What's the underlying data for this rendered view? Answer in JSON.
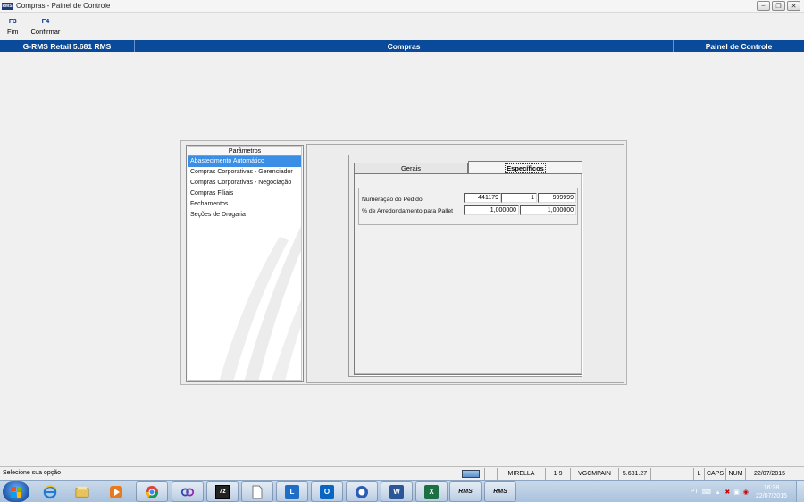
{
  "window": {
    "title": "Compras - Painel de Controle",
    "logo_text": "RMS"
  },
  "function_keys": [
    {
      "key": "F3",
      "label": "Fim"
    },
    {
      "key": "F4",
      "label": "Confirmar"
    }
  ],
  "header": {
    "left": "G-RMS Retail 5.681 RMS",
    "center": "Compras",
    "right": "Painel de Controle"
  },
  "parametros": {
    "title": "Parâmetros",
    "items": [
      "Abastecimento Automático",
      "Compras Corporativas - Gerenciador",
      "Compras Corporativas - Negociação",
      "Compras Filiais",
      "Fechamentos",
      "Seções de Drogaria"
    ],
    "selected_index": 0
  },
  "tabs": {
    "gerais": "Gerais",
    "especificos": "Específicos",
    "active": "especificos"
  },
  "form": {
    "numeracao_label": "Numeração do Pedido",
    "numeracao_values": [
      "441179",
      "1",
      "999999"
    ],
    "arredondamento_label": "% de Arredondamento para Pallet",
    "arredondamento_values": [
      "1,000000",
      "1,000000"
    ]
  },
  "statusbar": {
    "message": "Selecione sua opção",
    "user": "MIRELLA",
    "range": "1-9",
    "program": "VGCMPAIN",
    "version": "5.681.27",
    "l": "L",
    "caps": "CAPS",
    "num": "NUM",
    "date": "22/07/2015"
  },
  "taskbar": {
    "apps": [
      "windows-explorer",
      "internet-explorer",
      "file-manager",
      "media-player",
      "chrome",
      "app-chain",
      "7zip",
      "document",
      "lync",
      "outlook",
      "onenote",
      "word",
      "excel",
      "rms-1",
      "rms-2"
    ],
    "rms_label": "RMS",
    "lang": "PT",
    "time": "16:38",
    "date": "22/07/2015"
  },
  "colors": {
    "header_blue": "#0a4a9a",
    "selection_blue": "#3a8ee6"
  }
}
